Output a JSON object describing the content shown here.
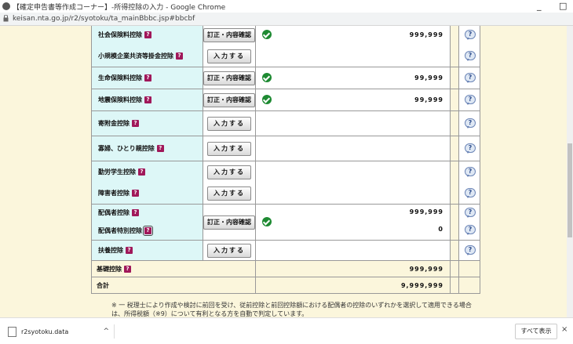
{
  "window": {
    "title": "【確定申告書等作成コーナー】-所得控除の入力 - Google Chrome",
    "minimize": "_",
    "restore": "□"
  },
  "address": {
    "url": "keisan.nta.go.jp/r2/syotoku/ta_mainBbbc.jsp#bbcbf"
  },
  "buttons": {
    "edit": "訂正・内容確認",
    "input": "入力する"
  },
  "help_glyph": "?",
  "q_glyph": "?",
  "rows": {
    "shakai_hoken": {
      "label": "社会保険料控除",
      "value": "999,999"
    },
    "shokibo": {
      "label": "小規模企業共済等掛金控除"
    },
    "seimei": {
      "label": "生命保険料控除",
      "value": "99,999"
    },
    "jishin": {
      "label": "地震保険料控除",
      "value": "99,999"
    },
    "kifukin": {
      "label": "寄附金控除"
    },
    "kafu": {
      "label": "寡婦、ひとり親控除"
    },
    "kinro": {
      "label": "勤労学生控除"
    },
    "shogaisha": {
      "label": "障害者控除"
    },
    "haigusha": {
      "label": "配偶者控除",
      "value": "999,999"
    },
    "haigusha_tokubetsu": {
      "label": "配偶者特別控除",
      "value": "0"
    },
    "fuyo": {
      "label": "扶養控除"
    },
    "kiso": {
      "label": "基礎控除",
      "value": "999,999"
    },
    "total": {
      "label": "合計",
      "value": "9,999,999"
    }
  },
  "note": "※ 一 税理士により作成や検討に前回を受け、従前控除と前回控除額における配偶者の控除のいずれかを選択して適用できる場合は、所得税額（※9）について有利となる方を自動で判定しています。",
  "downloads": {
    "filename": "r2syotoku.data",
    "show_all": "すべて表示",
    "close": "×",
    "chevron": "^"
  }
}
